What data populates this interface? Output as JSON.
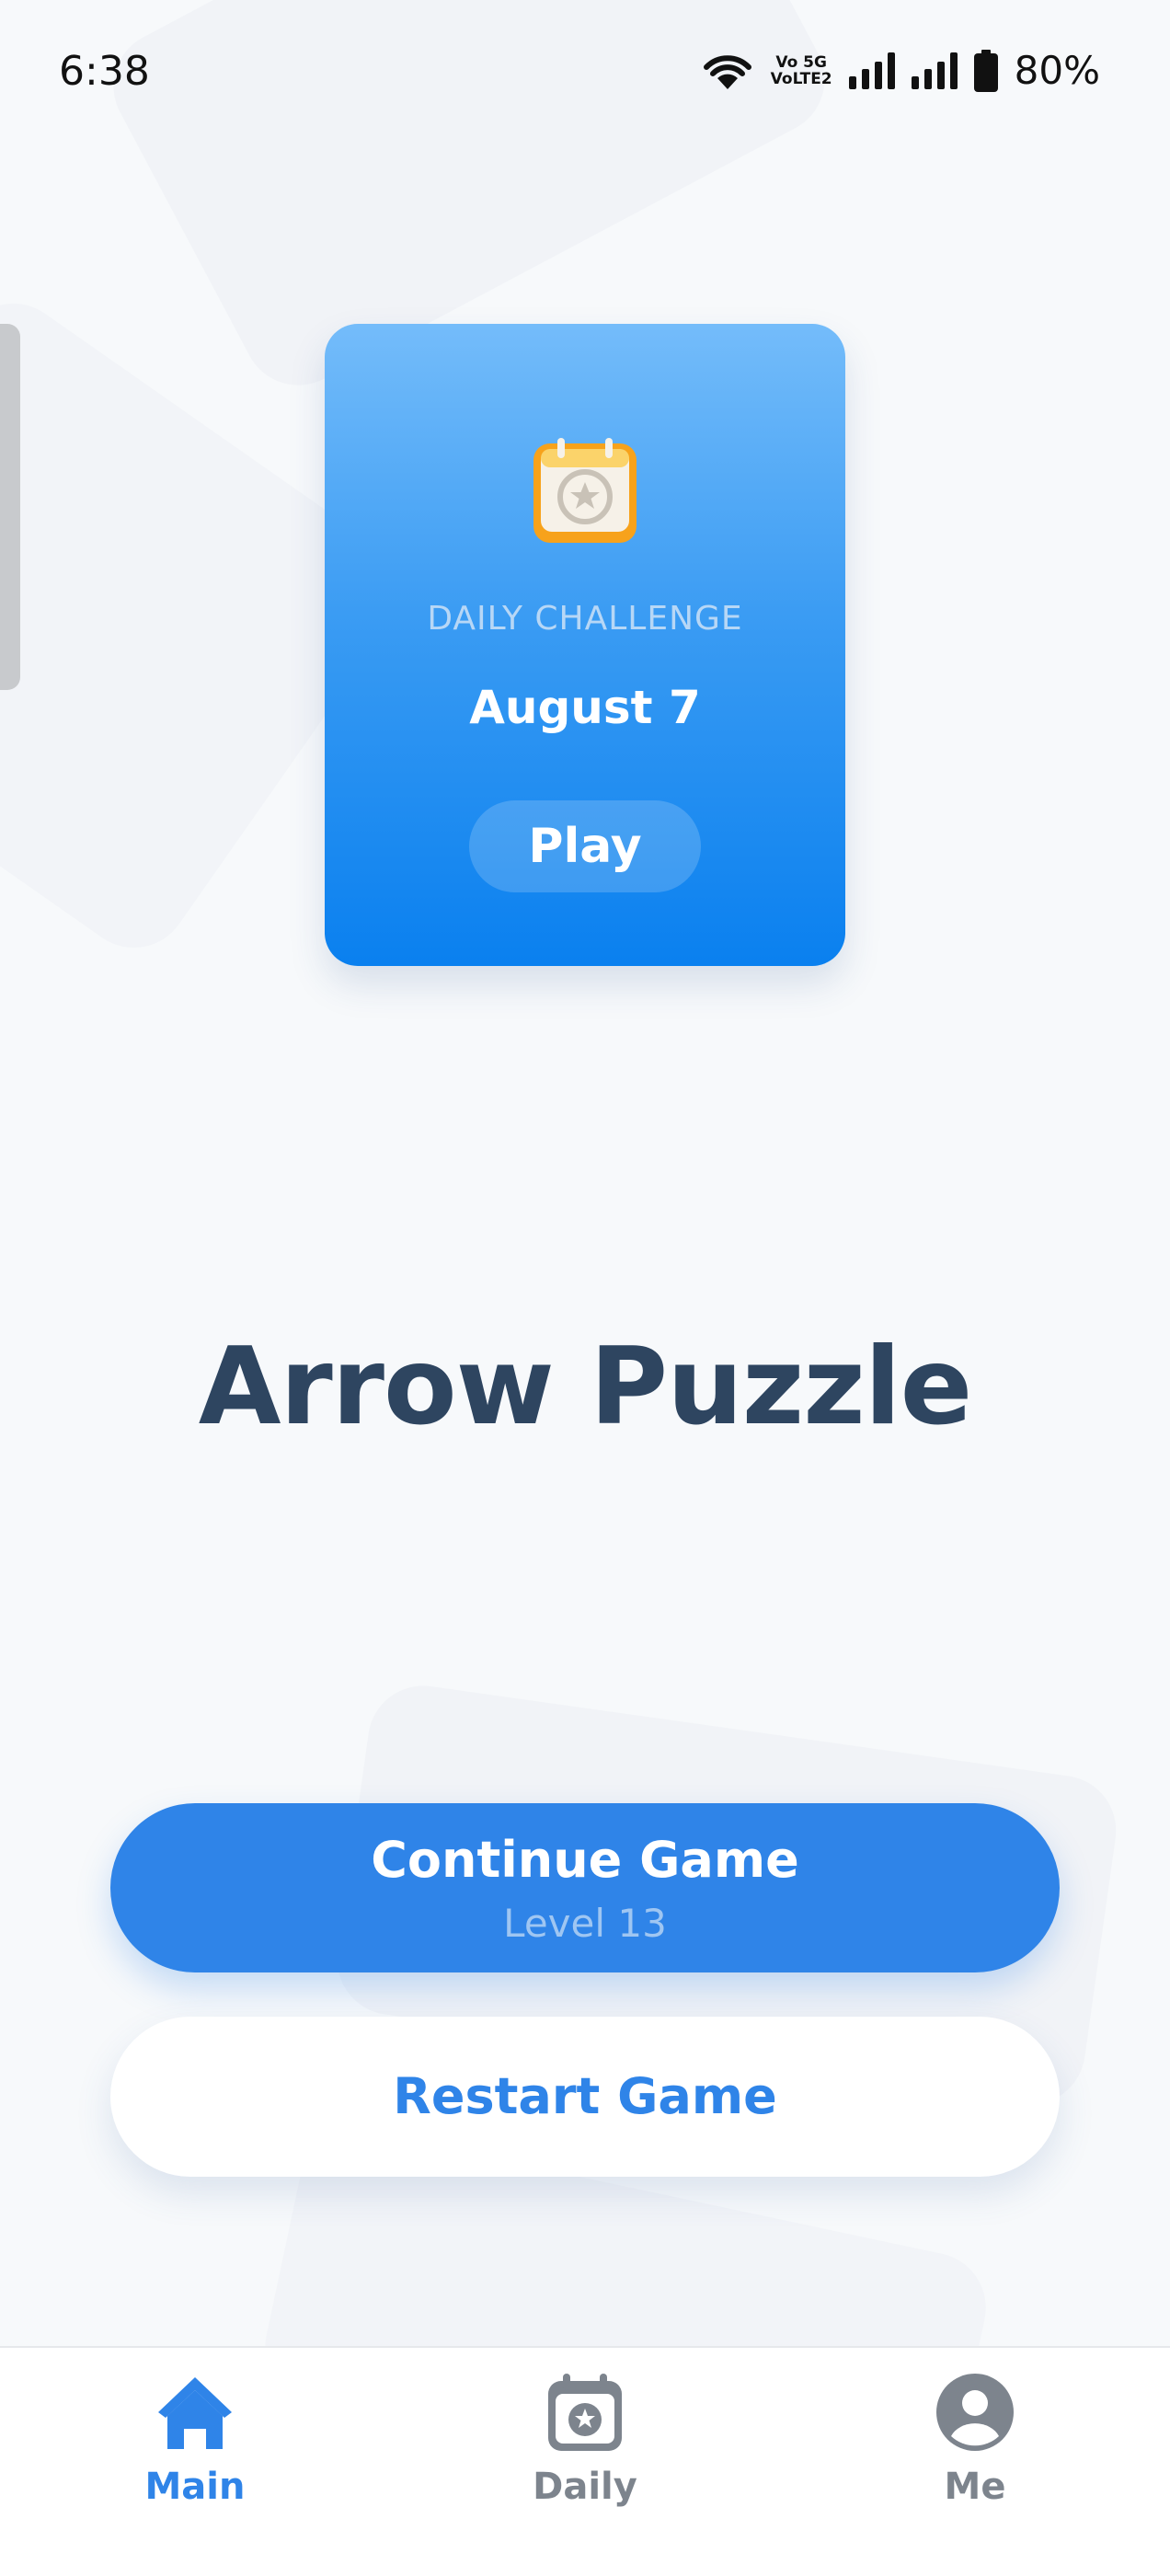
{
  "status_bar": {
    "time": "6:38",
    "battery": "80%",
    "network_label_top": "Vo 5G",
    "network_label_bottom": "VoLTE2"
  },
  "daily_challenge": {
    "icon": "calendar-star-icon",
    "label": "DAILY CHALLENGE",
    "date": "August 7",
    "play_label": "Play"
  },
  "title": "Arrow Puzzle",
  "continue_button": {
    "label": "Continue Game",
    "sublabel": "Level 13"
  },
  "restart_button": {
    "label": "Restart Game"
  },
  "nav": {
    "items": [
      {
        "label": "Main",
        "icon": "home-icon",
        "active": true
      },
      {
        "label": "Daily",
        "icon": "calendar-star-icon",
        "active": false
      },
      {
        "label": "Me",
        "icon": "user-icon",
        "active": false
      }
    ]
  },
  "colors": {
    "accent": "#2f84e8",
    "title": "#2e4560",
    "nav_inactive": "#7d848d"
  }
}
